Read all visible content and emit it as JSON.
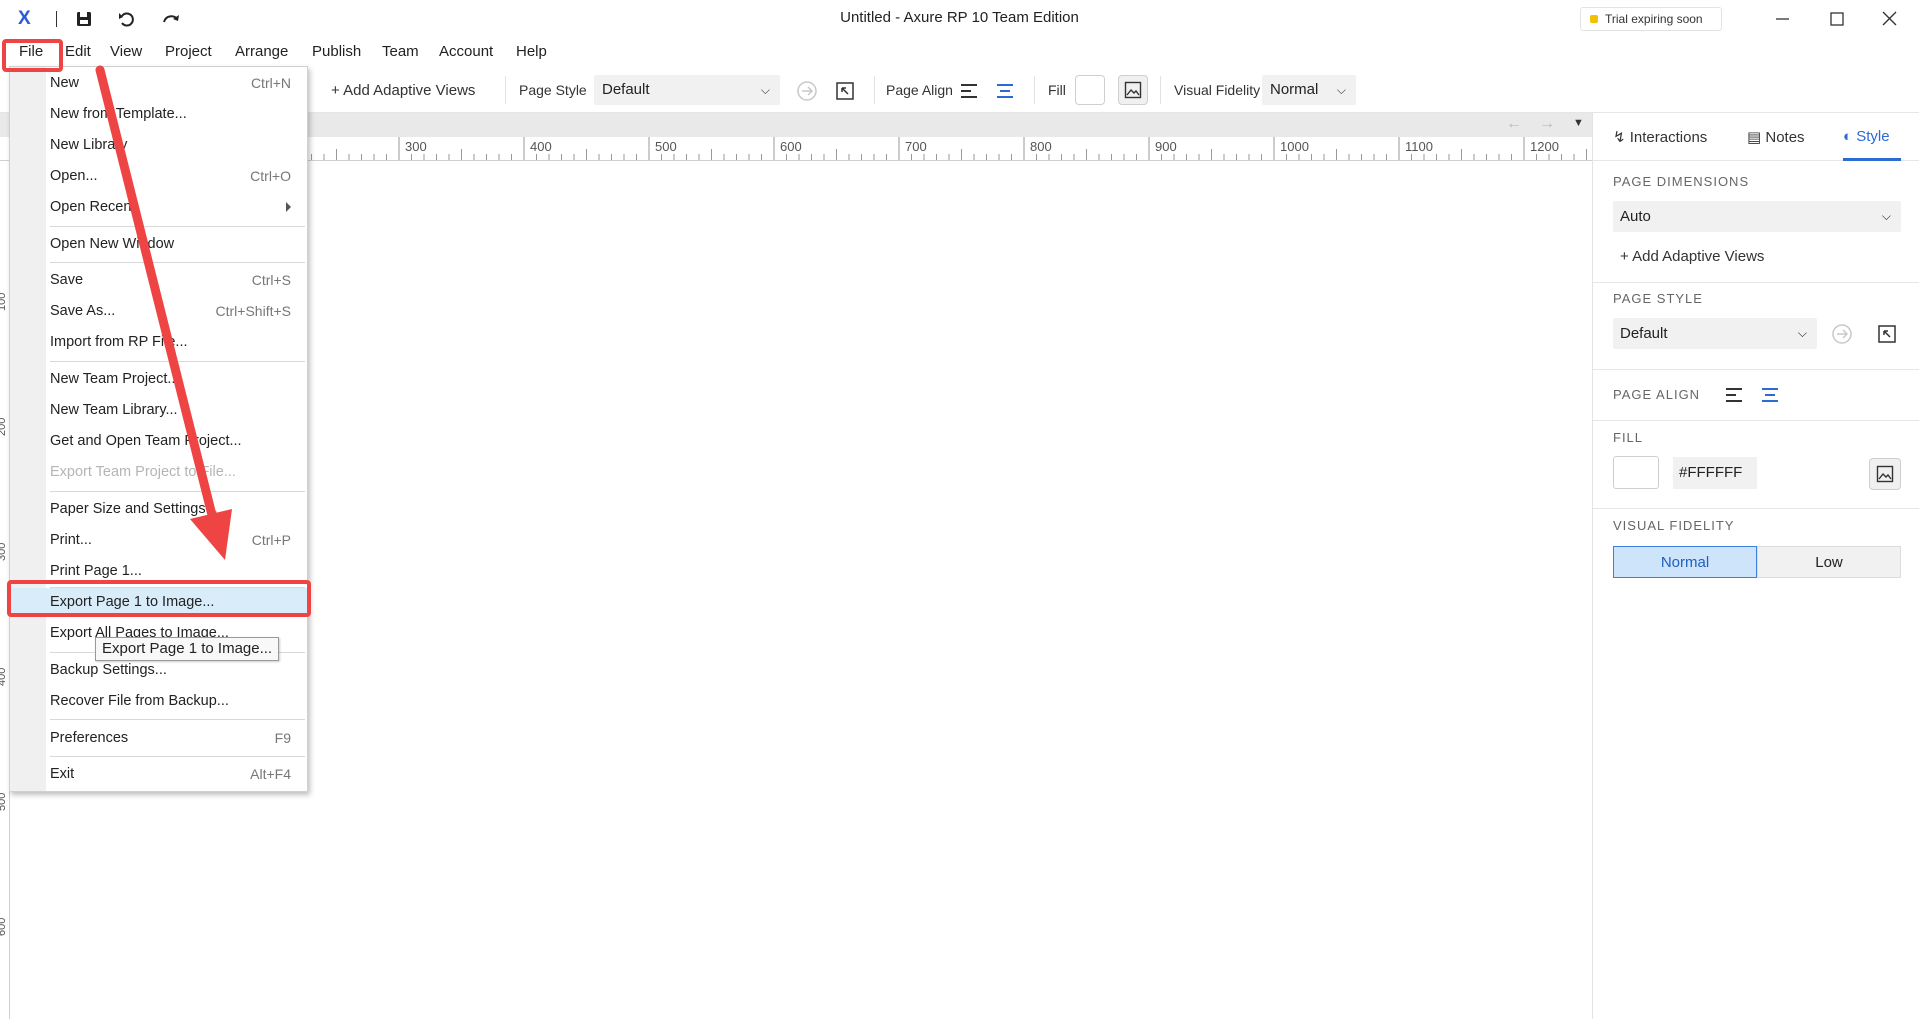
{
  "window": {
    "title": "Untitled - Axure RP 10 Team Edition",
    "trial_badge": "Trial expiring soon"
  },
  "menubar": {
    "items": [
      "File",
      "Edit",
      "View",
      "Project",
      "Arrange",
      "Publish",
      "Team",
      "Account",
      "Help"
    ]
  },
  "toolbar": {
    "add_adaptive_views": "+ Add Adaptive Views",
    "page_style_label": "Page Style",
    "page_style_value": "Default",
    "page_align_label": "Page Align",
    "fill_label": "Fill",
    "visual_fidelity_label": "Visual Fidelity",
    "visual_fidelity_value": "Normal"
  },
  "ruler": {
    "h_ticks": [
      "300",
      "400",
      "500",
      "600",
      "700",
      "800",
      "900",
      "1000",
      "1100",
      "1200"
    ],
    "v_ticks": [
      "100",
      "200",
      "300",
      "400",
      "500",
      "600"
    ]
  },
  "file_menu": {
    "items": [
      {
        "label": "New",
        "shortcut": "Ctrl+N"
      },
      {
        "label": "New from Template...",
        "shortcut": ""
      },
      {
        "label": "New Library",
        "shortcut": ""
      },
      {
        "label": "Open...",
        "shortcut": "Ctrl+O"
      },
      {
        "label": "Open Recent",
        "shortcut": ""
      },
      {
        "label": "Open New Window",
        "shortcut": ""
      },
      {
        "label": "Save",
        "shortcut": "Ctrl+S"
      },
      {
        "label": "Save As...",
        "shortcut": "Ctrl+Shift+S"
      },
      {
        "label": "Import from RP File...",
        "shortcut": ""
      },
      {
        "label": "New Team Project...",
        "shortcut": ""
      },
      {
        "label": "New Team Library...",
        "shortcut": ""
      },
      {
        "label": "Get and Open Team Project...",
        "shortcut": ""
      },
      {
        "label": "Export Team Project to File...",
        "shortcut": ""
      },
      {
        "label": "Paper Size and Settings...",
        "shortcut": ""
      },
      {
        "label": "Print...",
        "shortcut": "Ctrl+P"
      },
      {
        "label": "Print Page 1...",
        "shortcut": ""
      },
      {
        "label": "Export Page 1 to Image...",
        "shortcut": ""
      },
      {
        "label": "Export All Pages to Image...",
        "shortcut": ""
      },
      {
        "label": "Backup Settings...",
        "shortcut": ""
      },
      {
        "label": "Recover File from Backup...",
        "shortcut": ""
      },
      {
        "label": "Preferences",
        "shortcut": "F9"
      },
      {
        "label": "Exit",
        "shortcut": "Alt+F4"
      }
    ],
    "tooltip": "Export Page 1 to Image..."
  },
  "right_panel": {
    "tabs": [
      "Interactions",
      "Notes",
      "Style"
    ],
    "page_dimensions_label": "PAGE DIMENSIONS",
    "page_dimensions_value": "Auto",
    "add_adaptive_views": "+ Add Adaptive Views",
    "page_style_label": "PAGE STYLE",
    "page_style_value": "Default",
    "page_align_label": "PAGE ALIGN",
    "fill_label": "FILL",
    "fill_hex": "#FFFFFF",
    "visual_fidelity_label": "VISUAL FIDELITY",
    "fidelity_normal": "Normal",
    "fidelity_low": "Low"
  },
  "colors": {
    "accent": "#2a6bd6",
    "annotation": "#ef4444",
    "menu_highlight": "#d9ecfa"
  }
}
